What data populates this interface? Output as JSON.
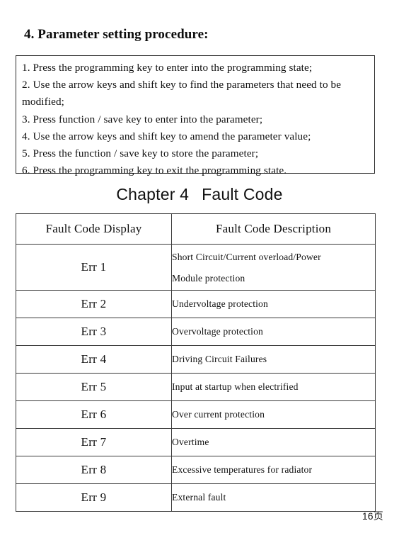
{
  "section": {
    "title": "4. Parameter setting procedure:"
  },
  "procedure": {
    "steps": [
      "1. Press the programming key to enter into the programming  state;",
      "2. Use the arrow keys and shift key to find the parameters that need to be modified;",
      "3. Press function / save key to enter into the parameter;",
      "4. Use the arrow keys and shift key to amend the parameter value;",
      "5. Press the function / save key to store the parameter;",
      "6. Press the programming key to exit the programming  state."
    ]
  },
  "chapter": {
    "label": "Chapter 4",
    "title": "Fault Code"
  },
  "fault_table": {
    "headers": [
      "Fault Code Display",
      "Fault Code Description"
    ],
    "rows": [
      {
        "code": "Err 1",
        "description_lines": [
          "Short Circuit/Current overload/Power",
          "Module protection"
        ]
      },
      {
        "code": "Err 2",
        "description_lines": [
          "Undervoltage  protection"
        ]
      },
      {
        "code": "Err 3",
        "description_lines": [
          "Overvoltage  protection"
        ]
      },
      {
        "code": "Err 4",
        "description_lines": [
          "Driving  Circuit Failures"
        ]
      },
      {
        "code": "Err 5",
        "description_lines": [
          "Input  at startup when  electrified"
        ]
      },
      {
        "code": "Err 6",
        "description_lines": [
          "Over  current protection"
        ]
      },
      {
        "code": "Err 7",
        "description_lines": [
          "Overtime"
        ]
      },
      {
        "code": "Err 8",
        "description_lines": [
          "Excessive temperatures for radiator"
        ]
      },
      {
        "code": "Err 9",
        "description_lines": [
          "External  fault"
        ]
      }
    ]
  },
  "footer": {
    "page_label": "16页"
  }
}
